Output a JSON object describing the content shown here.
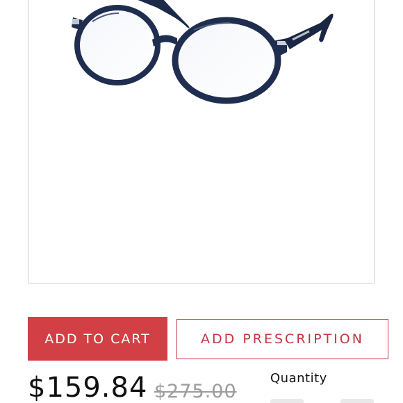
{
  "product": {
    "image_alt": "navy round eyeglasses",
    "frame_color": "#1f2d4f"
  },
  "actions": {
    "add_to_cart_label": "ADD TO CART",
    "add_prescription_label": "ADD PRESCRIPTION"
  },
  "pricing": {
    "current_price": "$159.84",
    "original_price": "$275.00"
  },
  "quantity": {
    "label": "Quantity"
  },
  "colors": {
    "accent_red": "#d23f45",
    "outline_red": "#c4353d",
    "muted_grey": "#9c9c9c"
  }
}
